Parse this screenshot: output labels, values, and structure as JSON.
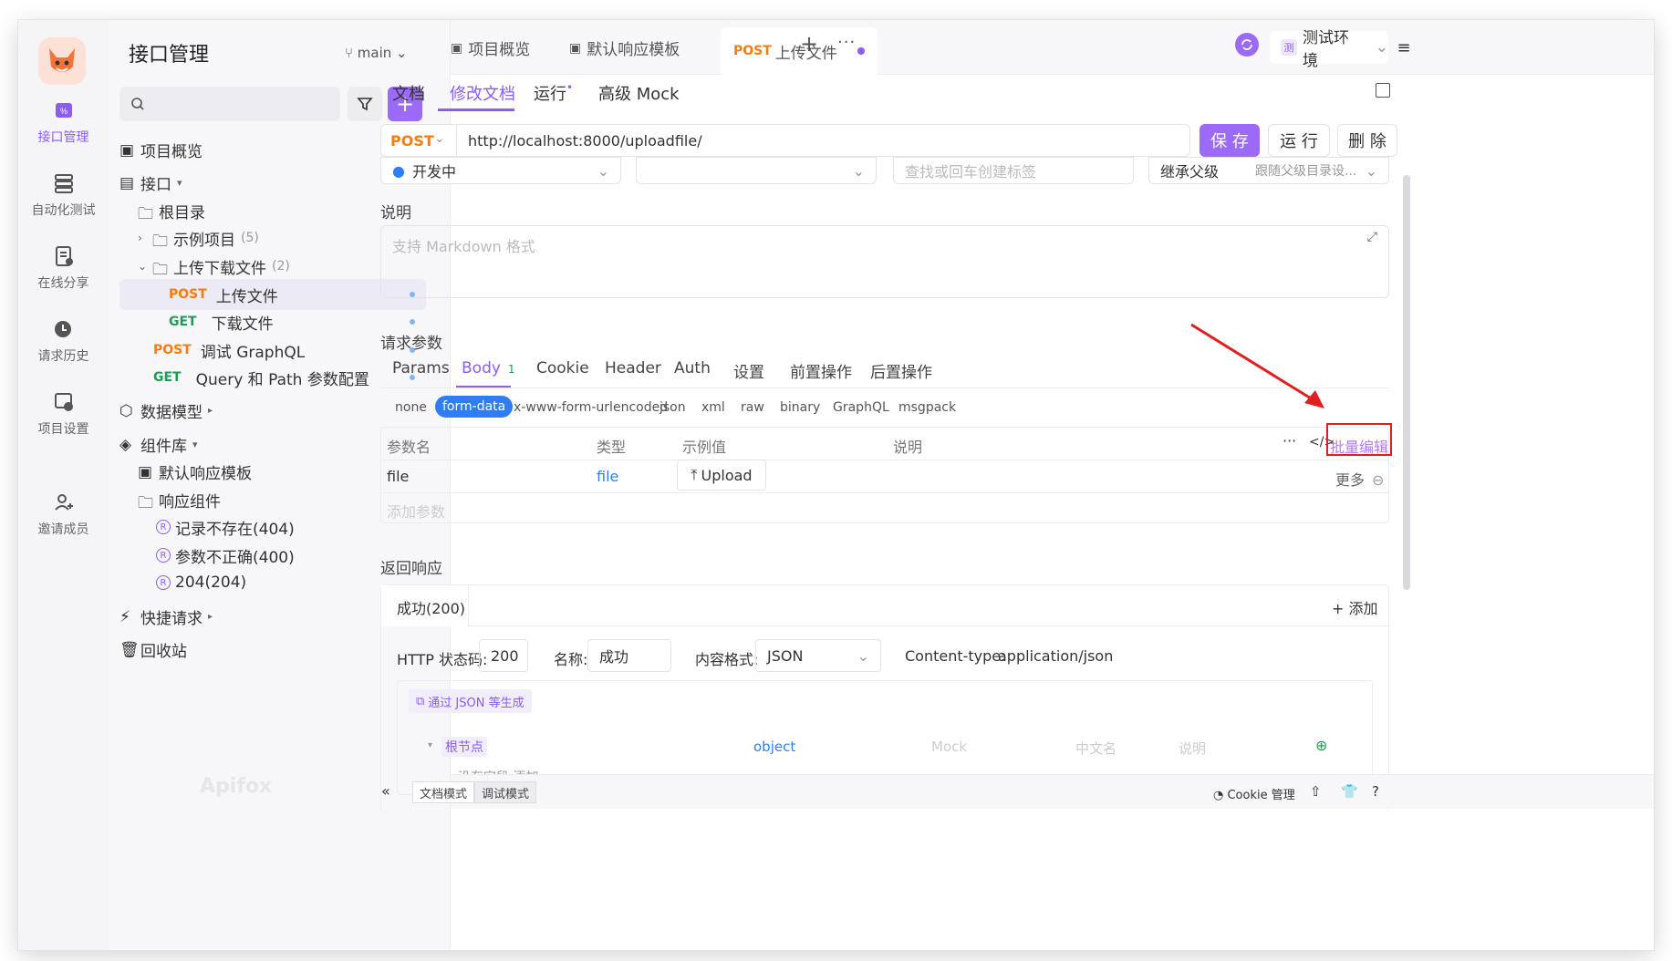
{
  "app": {
    "logo": "fox-logo",
    "watermark": "Apifox"
  },
  "rail": {
    "items": [
      {
        "label": "接口管理",
        "icon": "api-icon"
      },
      {
        "label": "自动化测试",
        "icon": "automation-icon"
      },
      {
        "label": "在线分享",
        "icon": "share-icon"
      },
      {
        "label": "请求历史",
        "icon": "history-icon"
      },
      {
        "label": "项目设置",
        "icon": "settings-icon"
      },
      {
        "label": "邀请成员",
        "icon": "invite-icon"
      }
    ]
  },
  "sidebar": {
    "title": "接口管理",
    "branch": "main",
    "tree": {
      "overview": "项目概览",
      "api": "接口",
      "root": "根目录",
      "example": "示例项目",
      "example_count": "(5)",
      "upload_folder": "上传下载文件",
      "upload_folder_count": "(2)",
      "upload_method": "POST",
      "upload_name": "上传文件",
      "download_method": "GET",
      "download_name": "下载文件",
      "graphql_method": "POST",
      "graphql_name": "调试 GraphQL",
      "query_method": "GET",
      "query_name": "Query 和 Path 参数配置",
      "data_model": "数据模型",
      "components": "组件库",
      "default_resp_tpl": "默认响应模板",
      "resp_components": "响应组件",
      "resp_404": "记录不存在(404)",
      "resp_400": "参数不正确(400)",
      "resp_204": "204(204)",
      "quick_request": "快捷请求",
      "trash": "回收站"
    }
  },
  "topbar": {
    "tabs": {
      "overview": "项目概览",
      "default_tpl": "默认响应模板",
      "active_method": "POST",
      "active_name": "上传文件"
    },
    "environment": "测试环境",
    "env_badge": "测"
  },
  "subtabs": {
    "doc": "文档",
    "edit_doc": "修改文档",
    "run": "运行",
    "mock": "高级 Mock"
  },
  "request": {
    "method": "POST",
    "url": "http://localhost:8000/uploadfile/",
    "save": "保 存",
    "run": "运 行",
    "delete": "删 除",
    "status": "开发中",
    "tag_placeholder": "查找或回车创建标签",
    "inherit_label": "继承父级",
    "inherit_value": "跟随父级目录设..."
  },
  "description": {
    "label": "说明",
    "placeholder": "支持 Markdown 格式"
  },
  "params": {
    "section_title": "请求参数",
    "tabs": [
      "Params",
      "Body",
      "Cookie",
      "Header",
      "Auth",
      "设置",
      "前置操作",
      "后置操作"
    ],
    "body_count": "1",
    "body_types": [
      "none",
      "form-data",
      "x-www-form-urlencoded",
      "json",
      "xml",
      "raw",
      "binary",
      "GraphQL",
      "msgpack"
    ],
    "columns": {
      "name": "参数名",
      "type": "类型",
      "example": "示例值",
      "desc": "说明"
    },
    "bulk_edit": "批量编辑",
    "row": {
      "name": "file",
      "type": "file",
      "upload": "Upload",
      "more": "更多"
    },
    "add_placeholder": "添加参数"
  },
  "response": {
    "section_title": "返回响应",
    "tab": "成功(200)",
    "add": "添加",
    "http_status_label": "HTTP 状态码:",
    "http_status": "200",
    "name_label": "名称:",
    "name": "成功",
    "format_label": "内容格式:",
    "format": "JSON",
    "content_type_label": "Content-type:",
    "content_type": "application/json",
    "gen_json": "通过 JSON 等生成",
    "root_node": "根节点",
    "root_type": "object",
    "col_mock": "Mock",
    "col_cn": "中文名",
    "col_desc": "说明",
    "partial_text": "没有字段 添加"
  },
  "bottombar": {
    "doc_mode": "文档模式",
    "debug_mode": "调试模式",
    "cookie": "Cookie 管理"
  },
  "colors": {
    "accent": "#8b5cf6",
    "post": "#f57c12",
    "get": "#1f9d55",
    "annotation": "#e02020"
  }
}
